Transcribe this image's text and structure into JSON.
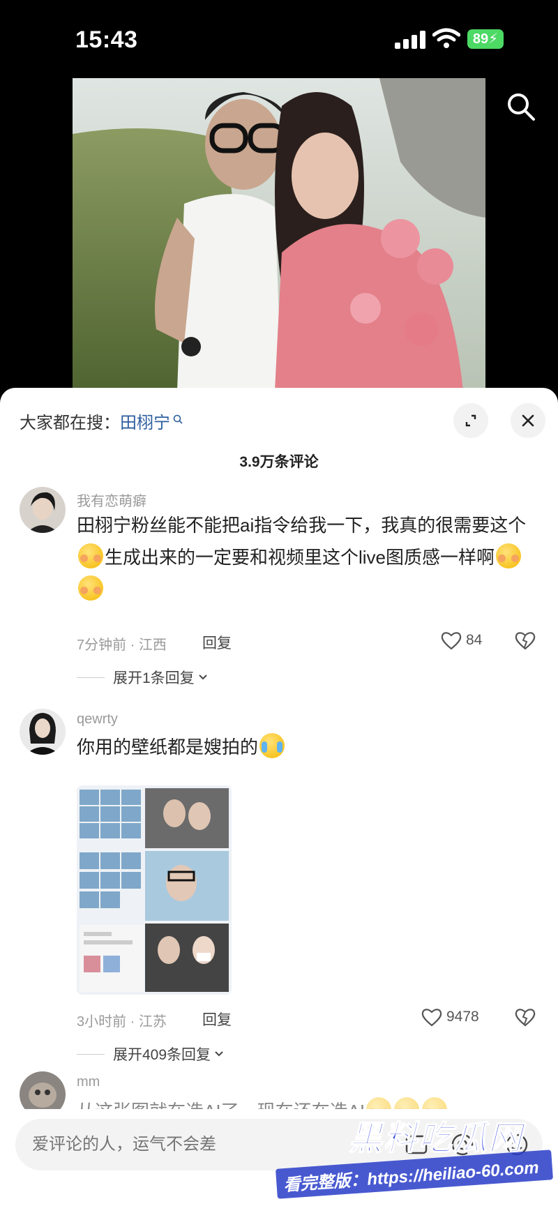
{
  "status_bar": {
    "time": "15:43",
    "battery": "89"
  },
  "video": {
    "search_icon": "search-icon"
  },
  "panel": {
    "trending_prefix": "大家都在搜：",
    "trending_keyword": "田栩宁",
    "comment_count": "3.9万条评论",
    "expand_icon": "expand-icon",
    "close_icon": "close-icon"
  },
  "comments": [
    {
      "username": "我有恋萌癖",
      "line1": "田栩宁粉丝能不能把ai指令给我一下，我真的很需要这个",
      "line2": "生成出来的一定要和视频里这个live图质感一样啊",
      "meta": "7分钟前 · 江西",
      "reply": "回复",
      "likes": "84",
      "expand": "展开1条回复"
    },
    {
      "username": "qewrty",
      "text": "你用的壁纸都是嫂拍的",
      "meta": "3小时前 · 江苏",
      "reply": "回复",
      "likes": "9478",
      "expand": "展开409条回复"
    },
    {
      "username": "mm",
      "text": "从这张图就在造AI了，现在还在造AI"
    }
  ],
  "input": {
    "placeholder": "爱评论的人，运气不会差"
  },
  "watermark": {
    "title": "黑料吃瓜网",
    "url": "看完整版：https://heiliao-60.com"
  },
  "colors": {
    "keyword": "#2c5e9e",
    "battery": "#4cd964",
    "watermark": "#2a3fd8"
  }
}
